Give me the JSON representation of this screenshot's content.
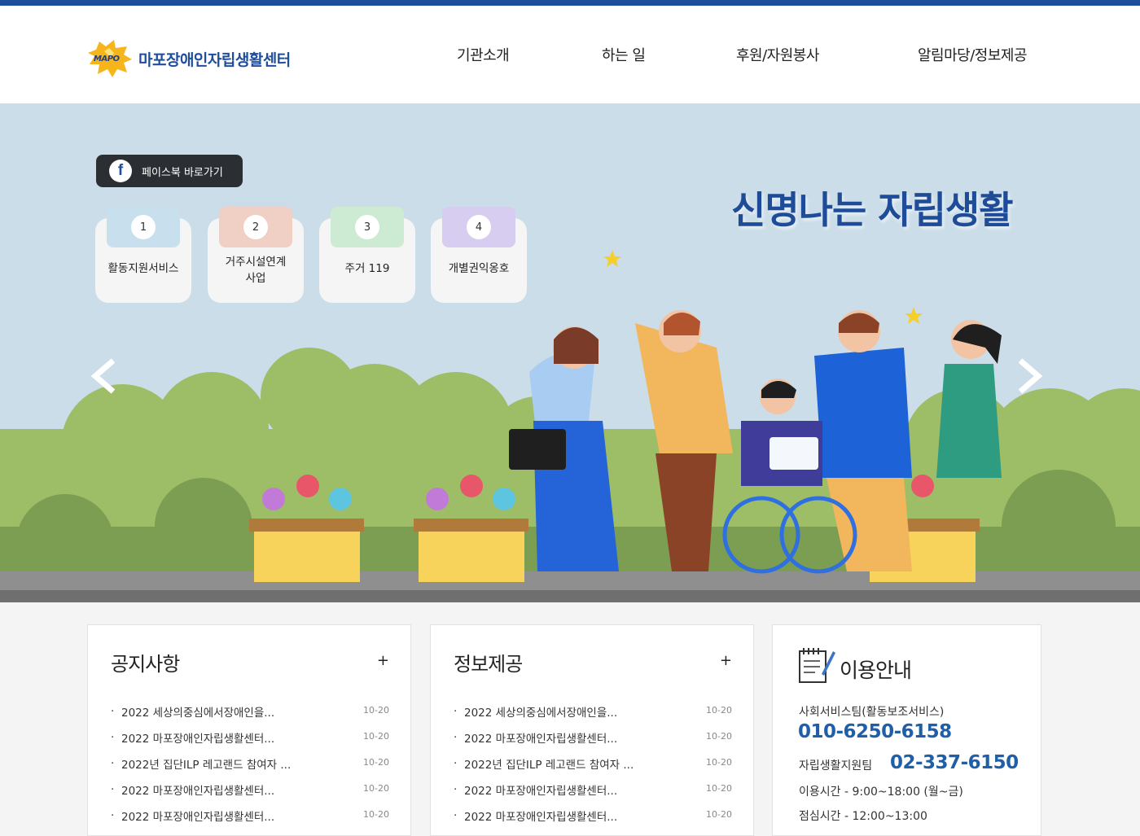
{
  "brand": {
    "logo_mark": "MAPO",
    "name": "마포장애인자립생활센터"
  },
  "nav": [
    "기관소개",
    "하는 일",
    "후원/자원봉사",
    "알림마당/정보제공"
  ],
  "hero": {
    "facebook_label": "페이스북 바로가기",
    "slogan": "신명나는 자립생활",
    "services": [
      {
        "num": "1",
        "label": "활동지원서비스",
        "color": "#c8e0ee"
      },
      {
        "num": "2",
        "label": "거주시설연계\n사업",
        "color": "#f0cfc5"
      },
      {
        "num": "3",
        "label": "주거 119",
        "color": "#cdebd2"
      },
      {
        "num": "4",
        "label": "개별권익옹호",
        "color": "#d7cdf0"
      }
    ]
  },
  "notice": {
    "title": "공지사항",
    "more": "+",
    "posts": [
      {
        "title": "2022 세상의중심에서장애인을...",
        "date": "10-20"
      },
      {
        "title": "2022 마포장애인자립생활센터...",
        "date": "10-20"
      },
      {
        "title": "2022년 집단ILP 레고랜드 참여자 ...",
        "date": "10-20"
      },
      {
        "title": "2022 마포장애인자립생활센터...",
        "date": "10-20"
      },
      {
        "title": "2022 마포장애인자립생활센터...",
        "date": "10-20"
      }
    ]
  },
  "info": {
    "title": "정보제공",
    "more": "+",
    "posts": [
      {
        "title": "2022 세상의중심에서장애인을...",
        "date": "10-20"
      },
      {
        "title": "2022 마포장애인자립생활센터...",
        "date": "10-20"
      },
      {
        "title": "2022년 집단ILP 레고랜드 참여자 ...",
        "date": "10-20"
      },
      {
        "title": "2022 마포장애인자립생활센터...",
        "date": "10-20"
      },
      {
        "title": "2022 마포장애인자립생활센터...",
        "date": "10-20"
      }
    ]
  },
  "guide": {
    "title": "이용안내",
    "social_team": "사회서비스팀(활동보조서비스)",
    "social_phone": "010-6250-6158",
    "living_team": "자립생활지원팀",
    "living_phone": "02-337-6150",
    "hours": "이용시간 - 9:00~18:00 (월~금)",
    "lunch": "점심시간 - 12:00~13:00"
  },
  "colors": {
    "top_bar": "#1d4f9c",
    "brand": "#1f4e9a",
    "hero_bg": "#cbdde8",
    "facebook": "#1b4e9e"
  }
}
